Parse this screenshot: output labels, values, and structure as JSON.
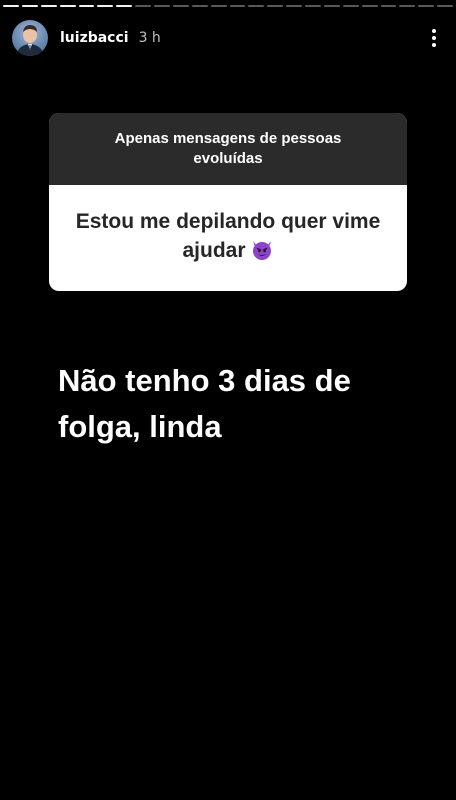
{
  "story": {
    "progress": {
      "segments_total": 24,
      "segments_viewed": 7
    }
  },
  "header": {
    "username": "luizbacci",
    "timestamp": "3 h",
    "avatar_icon": "profile-photo",
    "menu_icon": "more-vertical-icon"
  },
  "question_sticker": {
    "prompt": "Apenas mensagens de pessoas evoluídas",
    "answer": "Estou me depilando quer vime ajudar",
    "answer_emoji_icon": "smiling-devil-icon",
    "colors": {
      "header_bg": "#2b2b2b",
      "body_bg": "#ffffff",
      "answer_text": "#262626",
      "emoji": "#8e44c8"
    }
  },
  "reply": {
    "text": "Não tenho 3 dias de folga, linda"
  }
}
